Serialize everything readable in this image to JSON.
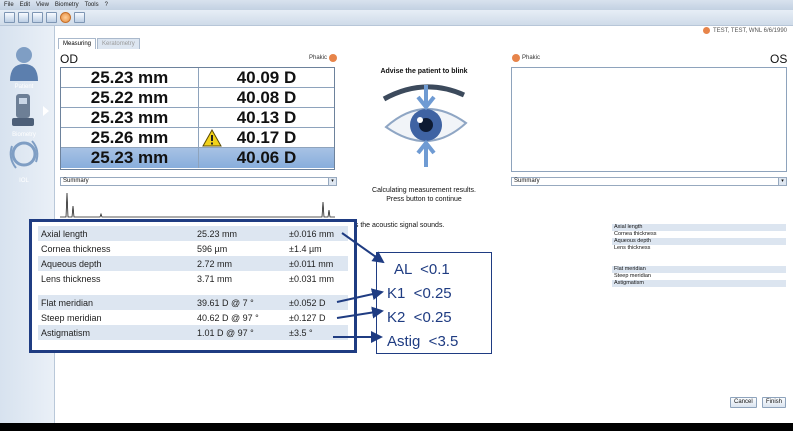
{
  "menu": [
    "File",
    "Edit",
    "View",
    "Biometry",
    "Tools",
    "?"
  ],
  "header": {
    "test_label": "TEST, TEST, WNL 6/6/1990"
  },
  "sidebar": {
    "items": [
      {
        "label": "Patient"
      },
      {
        "label": "Biometry"
      },
      {
        "label": "IOL"
      }
    ]
  },
  "tabs": [
    {
      "label": "Measuring"
    },
    {
      "label": "Keratometry"
    }
  ],
  "od": {
    "title": "OD",
    "phakic": "Phakic",
    "rows": [
      {
        "al": "25.23 mm",
        "k": "40.09 D",
        "warn": false,
        "selected": false
      },
      {
        "al": "25.22 mm",
        "k": "40.08 D",
        "warn": false,
        "selected": false
      },
      {
        "al": "25.23 mm",
        "k": "40.13 D",
        "warn": false,
        "selected": false
      },
      {
        "al": "25.26 mm",
        "k": "40.17 D",
        "warn": true,
        "selected": false
      },
      {
        "al": "25.23 mm",
        "k": "40.06 D",
        "warn": false,
        "selected": true
      }
    ],
    "summary_select": "Summary"
  },
  "os": {
    "title": "OS",
    "phakic": "Phakic",
    "summary_select": "Summary"
  },
  "center": {
    "advise": "Advise the patient to blink",
    "calc_line1": "Calculating measurement results.",
    "calc_line2": "Press button to continue"
  },
  "acoustic_text": "as the acoustic signal sounds.",
  "os_summary": {
    "group1": [
      "Axial length",
      "Cornea thickness",
      "Aqueous depth",
      "Lens thickness"
    ],
    "group2": [
      "Flat meridian",
      "Steep meridian",
      "Astigmatism"
    ]
  },
  "results": {
    "group1": [
      {
        "label": "Axial length",
        "value": "25.23 mm",
        "sd": "±0.016 mm"
      },
      {
        "label": "Cornea thickness",
        "value": "596 µm",
        "sd": "±1.4 µm"
      },
      {
        "label": "Aqueous depth",
        "value": "2.72 mm",
        "sd": "±0.011 mm"
      },
      {
        "label": "Lens thickness",
        "value": "3.71 mm",
        "sd": "±0.031 mm"
      }
    ],
    "group2": [
      {
        "label": "Flat meridian",
        "value": "39.61 D @ 7 °",
        "sd": "±0.052 D"
      },
      {
        "label": "Steep meridian",
        "value": "40.62 D @ 97 °",
        "sd": "±0.127 D"
      },
      {
        "label": "Astigmatism",
        "value": "1.01 D @ 97 °",
        "sd": "±3.5 °"
      }
    ]
  },
  "limits": [
    "AL  <0.1",
    "K1  <0.25",
    "K2  <0.25",
    "Astig  <3.5"
  ],
  "buttons": {
    "cancel": "Cancel",
    "finish": "Finish"
  },
  "colors": {
    "selected_row": "#88aedc",
    "annotation": "#1f3c82",
    "warning": "#f2d21a"
  }
}
